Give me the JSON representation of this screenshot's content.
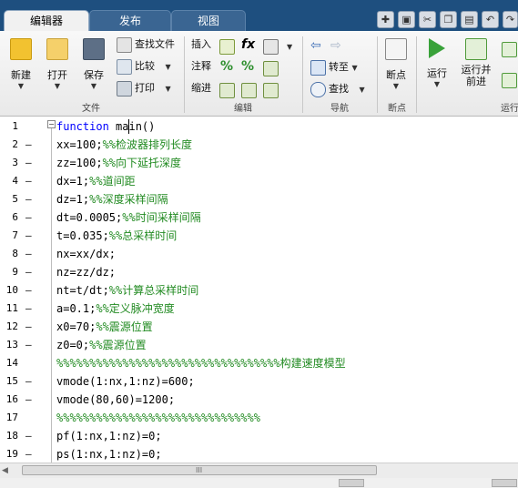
{
  "tabs": [
    {
      "label": "编辑器",
      "active": true
    },
    {
      "label": "发布",
      "active": false
    },
    {
      "label": "视图",
      "active": false
    }
  ],
  "quick_access": [
    "new-doc-icon",
    "save-icon",
    "cut-icon",
    "copy-icon",
    "paste-icon",
    "undo-icon",
    "redo-icon"
  ],
  "ribbon": {
    "file_group": {
      "label": "文件",
      "new_label": "新建",
      "open_label": "打开",
      "save_label": "保存",
      "find_files_label": "查找文件",
      "compare_label": "比较",
      "print_label": "打印"
    },
    "edit_group": {
      "label": "编辑",
      "insert_label": "插入",
      "comment_label": "注释",
      "indent_label": "缩进"
    },
    "nav_group": {
      "label": "导航",
      "goto_label": "转至",
      "find_label": "查找"
    },
    "breakpoint_group": {
      "label": "断点",
      "breakpoints_label": "断点"
    },
    "run_group": {
      "label": "运行",
      "run_label": "运行",
      "run_advance_label": "运行并\n前进"
    }
  },
  "code_lines": [
    {
      "n": "1",
      "dash": "",
      "kw": "function",
      "code": " main()",
      "cm": ""
    },
    {
      "n": "2",
      "dash": "–",
      "kw": "",
      "code": "xx=100;",
      "cm": "%%检波器排列长度"
    },
    {
      "n": "3",
      "dash": "–",
      "kw": "",
      "code": "zz=100;",
      "cm": "%%向下延托深度"
    },
    {
      "n": "4",
      "dash": "–",
      "kw": "",
      "code": "dx=1;",
      "cm": "%%道间距"
    },
    {
      "n": "5",
      "dash": "–",
      "kw": "",
      "code": "dz=1;",
      "cm": "%%深度采样间隔"
    },
    {
      "n": "6",
      "dash": "–",
      "kw": "",
      "code": "dt=0.0005;",
      "cm": "%%时间采样间隔"
    },
    {
      "n": "7",
      "dash": "–",
      "kw": "",
      "code": "t=0.035;",
      "cm": "%%总采样时间"
    },
    {
      "n": "8",
      "dash": "–",
      "kw": "",
      "code": "nx=xx/dx;",
      "cm": ""
    },
    {
      "n": "9",
      "dash": "–",
      "kw": "",
      "code": "nz=zz/dz;",
      "cm": ""
    },
    {
      "n": "10",
      "dash": "–",
      "kw": "",
      "code": "nt=t/dt;",
      "cm": "%%计算总采样时间"
    },
    {
      "n": "11",
      "dash": "–",
      "kw": "",
      "code": "a=0.1;",
      "cm": "%%定义脉冲宽度"
    },
    {
      "n": "12",
      "dash": "–",
      "kw": "",
      "code": "x0=70;",
      "cm": "%%震源位置"
    },
    {
      "n": "13",
      "dash": "–",
      "kw": "",
      "code": "z0=0;",
      "cm": "%%震源位置"
    },
    {
      "n": "14",
      "dash": "",
      "kw": "",
      "code": "",
      "cm": "%%%%%%%%%%%%%%%%%%%%%%%%%%%%%%%%%%构建速度模型"
    },
    {
      "n": "15",
      "dash": "–",
      "kw": "",
      "code": "vmode(1:nx,1:nz)=600;",
      "cm": ""
    },
    {
      "n": "16",
      "dash": "–",
      "kw": "",
      "code": "vmode(80,60)=1200;",
      "cm": ""
    },
    {
      "n": "17",
      "dash": "",
      "kw": "",
      "code": "",
      "cm": "%%%%%%%%%%%%%%%%%%%%%%%%%%%%%%%"
    },
    {
      "n": "18",
      "dash": "–",
      "kw": "",
      "code": "pf(1:nx,1:nz)=0;",
      "cm": ""
    },
    {
      "n": "19",
      "dash": "–",
      "kw": "",
      "code": "ps(1:nx,1:nz)=0;",
      "cm": ""
    }
  ],
  "scrollbar": {
    "grip": "III"
  },
  "colors": {
    "tabbar": "#1e4f7f",
    "keyword": "#0000ff",
    "comment": "#228b22"
  }
}
